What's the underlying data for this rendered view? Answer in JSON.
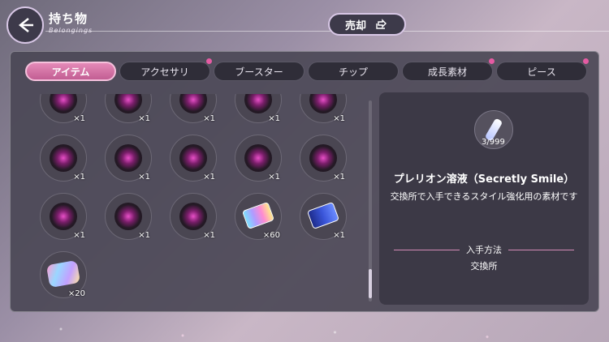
{
  "header": {
    "title": "持ち物",
    "subtitle": "Belongings",
    "sell_label": "売却"
  },
  "tabs": [
    {
      "label": "アイテム",
      "active": true,
      "badge": false
    },
    {
      "label": "アクセサリ",
      "active": false,
      "badge": true
    },
    {
      "label": "ブースター",
      "active": false,
      "badge": false
    },
    {
      "label": "チップ",
      "active": false,
      "badge": false
    },
    {
      "label": "成長素材",
      "active": false,
      "badge": true
    },
    {
      "label": "ピース",
      "active": false,
      "badge": true
    }
  ],
  "items": [
    {
      "kind": "blob",
      "count": "×1"
    },
    {
      "kind": "blob",
      "count": "×1"
    },
    {
      "kind": "blob",
      "count": "×1"
    },
    {
      "kind": "blob",
      "count": "×1"
    },
    {
      "kind": "blob",
      "count": "×1"
    },
    {
      "kind": "blob",
      "count": "×1"
    },
    {
      "kind": "blob",
      "count": "×1"
    },
    {
      "kind": "blob",
      "count": "×1"
    },
    {
      "kind": "blob",
      "count": "×1"
    },
    {
      "kind": "blob",
      "count": "×1"
    },
    {
      "kind": "blob",
      "count": "×1"
    },
    {
      "kind": "blob",
      "count": "×1"
    },
    {
      "kind": "blob",
      "count": "×1"
    },
    {
      "kind": "ticket",
      "count": "×60"
    },
    {
      "kind": "ticket-blue",
      "count": "×1"
    },
    {
      "kind": "rainbow",
      "count": "×20"
    }
  ],
  "detail": {
    "count": "3/999",
    "name": "プレリオン溶液（Secretly Smile）",
    "description": "交換所で入手できるスタイル強化用の素材です",
    "source_label": "入手方法",
    "source_value": "交換所"
  },
  "colors": {
    "active_tab": "#d774a8",
    "badge": "#e55ba3",
    "panel": "#4b4856"
  }
}
